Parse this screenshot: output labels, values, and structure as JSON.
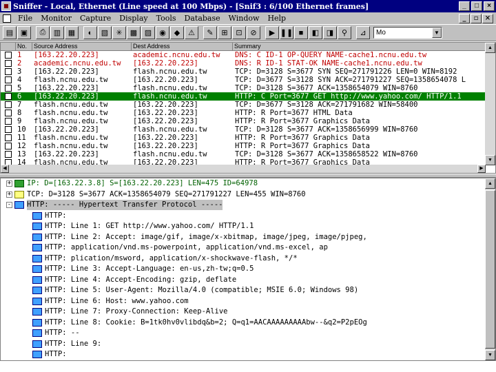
{
  "window": {
    "title": "Sniffer - Local, Ethernet (Line speed at 100 Mbps) - [Snif3 : 6/100 Ethernet frames]"
  },
  "menu": [
    {
      "label": "File"
    },
    {
      "label": "Monitor"
    },
    {
      "label": "Capture"
    },
    {
      "label": "Display"
    },
    {
      "label": "Tools"
    },
    {
      "label": "Database"
    },
    {
      "label": "Window"
    },
    {
      "label": "Help"
    }
  ],
  "toolbar": {
    "filter_value": "Mo"
  },
  "summary": {
    "columns": [
      "No.",
      "Source Address",
      "Dest Address",
      "Summary"
    ],
    "rows": [
      {
        "no": "1",
        "src": "[163.22.20.223]",
        "dst": "academic.ncnu.edu.tw",
        "summary": "DNS: C ID-1 OP-QUERY NAME-cache1.ncnu.edu.tw",
        "style": "red"
      },
      {
        "no": "2",
        "src": "academic.ncnu.edu.tw",
        "dst": "[163.22.20.223]",
        "summary": "DNS: R ID-1 STAT-OK NAME-cache1.ncnu.edu.tw",
        "style": "red"
      },
      {
        "no": "3",
        "src": "[163.22.20.223]",
        "dst": "flash.ncnu.edu.tw",
        "summary": "TCP: D=3128 S=3677 SYN SEQ=271791226 LEN=0 WIN=8192",
        "style": ""
      },
      {
        "no": "4",
        "src": "flash.ncnu.edu.tw",
        "dst": "[163.22.20.223]",
        "summary": "TCP: D=3677 S=3128 SYN ACK=271791227 SEQ=1358654078 L",
        "style": ""
      },
      {
        "no": "5",
        "src": "[163.22.20.223]",
        "dst": "flash.ncnu.edu.tw",
        "summary": "TCP: D=3128 S=3677 ACK=1358654079 WIN=8760",
        "style": ""
      },
      {
        "no": "6",
        "src": "[163.22.20.223]",
        "dst": "flash.ncnu.edu.tw",
        "summary": "HTTP: C Port=3677 GET http://www.yahoo.com/ HTTP/1.1",
        "style": "sel"
      },
      {
        "no": "7",
        "src": "flash.ncnu.edu.tw",
        "dst": "[163.22.20.223]",
        "summary": "TCP: D=3677 S=3128 ACK=271791682 WIN=58400",
        "style": ""
      },
      {
        "no": "8",
        "src": "flash.ncnu.edu.tw",
        "dst": "[163.22.20.223]",
        "summary": "HTTP: R Port=3677 HTML Data",
        "style": ""
      },
      {
        "no": "9",
        "src": "flash.ncnu.edu.tw",
        "dst": "[163.22.20.223]",
        "summary": "HTTP: R Port=3677 Graphics Data",
        "style": ""
      },
      {
        "no": "10",
        "src": "[163.22.20.223]",
        "dst": "flash.ncnu.edu.tw",
        "summary": "TCP: D=3128 S=3677 ACK=1358656999 WIN=8760",
        "style": ""
      },
      {
        "no": "11",
        "src": "flash.ncnu.edu.tw",
        "dst": "[163.22.20.223]",
        "summary": "HTTP: R Port=3677 Graphics Data",
        "style": ""
      },
      {
        "no": "12",
        "src": "flash.ncnu.edu.tw",
        "dst": "[163.22.20.223]",
        "summary": "HTTP: R Port=3677 Graphics Data",
        "style": ""
      },
      {
        "no": "13",
        "src": "[163.22.20.223]",
        "dst": "flash.ncnu.edu.tw",
        "summary": "TCP: D=3128 S=3677 ACK=1358658522 WIN=8760",
        "style": ""
      },
      {
        "no": "14",
        "src": "flash.ncnu.edu.tw",
        "dst": "[163.22.20.223]",
        "summary": "HTTP: R Port=3677 Graphics Data",
        "style": ""
      }
    ]
  },
  "detail": {
    "lines": [
      {
        "text": "IP: D=[163.22.3.8] S=[163.22.20.223] LEN=475 ID=64978",
        "level": 0,
        "tree": "+",
        "icon": "green",
        "style": "green"
      },
      {
        "text": "TCP: D=3128 S=3677 ACK=1358654079 SEQ=271791227 LEN=455 WIN=8760",
        "level": 0,
        "tree": "+",
        "icon": "yellow",
        "style": ""
      },
      {
        "text": "HTTP: ----- Hypertext Transfer Protocol -----",
        "level": 0,
        "tree": "-",
        "icon": "blue",
        "style": "hl"
      },
      {
        "text": "HTTP:",
        "level": 1,
        "tree": "",
        "icon": "blue",
        "style": ""
      },
      {
        "text": "HTTP: Line  1:  GET http://www.yahoo.com/ HTTP/1.1",
        "level": 1,
        "tree": "",
        "icon": "blue",
        "style": ""
      },
      {
        "text": "HTTP: Line  2:  Accept: image/gif, image/x-xbitmap, image/jpeg, image/pjpeg,",
        "level": 1,
        "tree": "",
        "icon": "blue",
        "style": ""
      },
      {
        "text": "HTTP:            application/vnd.ms-powerpoint, application/vnd.ms-excel, ap",
        "level": 1,
        "tree": "",
        "icon": "blue",
        "style": ""
      },
      {
        "text": "HTTP:           plication/msword, application/x-shockwave-flash, */*",
        "level": 1,
        "tree": "",
        "icon": "blue",
        "style": ""
      },
      {
        "text": "HTTP: Line  3:  Accept-Language: en-us,zh-tw;q=0.5",
        "level": 1,
        "tree": "",
        "icon": "blue",
        "style": ""
      },
      {
        "text": "HTTP: Line  4:  Accept-Encoding: gzip, deflate",
        "level": 1,
        "tree": "",
        "icon": "blue",
        "style": ""
      },
      {
        "text": "HTTP: Line  5:  User-Agent: Mozilla/4.0 (compatible; MSIE 6.0; Windows 98)",
        "level": 1,
        "tree": "",
        "icon": "blue",
        "style": ""
      },
      {
        "text": "HTTP: Line  6:  Host: www.yahoo.com",
        "level": 1,
        "tree": "",
        "icon": "blue",
        "style": ""
      },
      {
        "text": "HTTP: Line  7:  Proxy-Connection: Keep-Alive",
        "level": 1,
        "tree": "",
        "icon": "blue",
        "style": ""
      },
      {
        "text": "HTTP: Line  8:  Cookie: B=1tk0hv0vlibdq&b=2; Q=q1=AACAAAAAAAAAbw--&q2=P2pEOg",
        "level": 1,
        "tree": "",
        "icon": "blue",
        "style": ""
      },
      {
        "text": "HTTP:           --",
        "level": 1,
        "tree": "",
        "icon": "blue",
        "style": ""
      },
      {
        "text": "HTTP: Line  9:",
        "level": 1,
        "tree": "",
        "icon": "blue",
        "style": ""
      },
      {
        "text": "HTTP:",
        "level": 1,
        "tree": "",
        "icon": "blue",
        "style": ""
      }
    ]
  },
  "colors": {
    "titlebar": "#000080",
    "selected_row": "#008000",
    "dns_text": "#c00000"
  }
}
